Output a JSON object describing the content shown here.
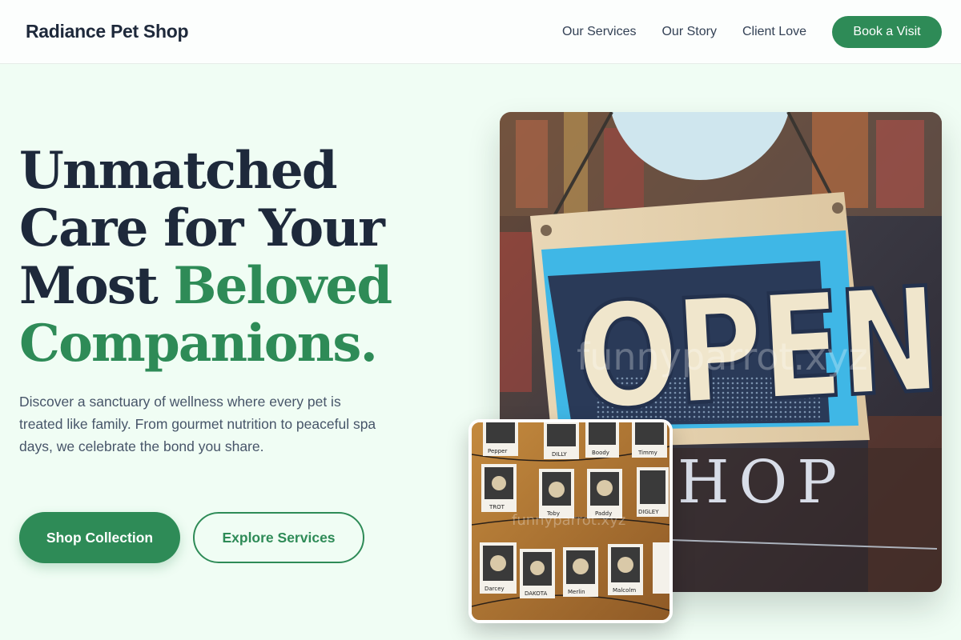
{
  "header": {
    "brand": "Radiance Pet Shop",
    "nav": [
      {
        "label": "Our Services"
      },
      {
        "label": "Our Story"
      },
      {
        "label": "Client Love"
      }
    ],
    "cta_label": "Book a Visit"
  },
  "hero": {
    "title_line1": "Unmatched",
    "title_line2": "Care for Your",
    "title_line3_plain": "Most ",
    "title_line3_accent": "Beloved",
    "title_line4_accent": "Companions.",
    "description": "Discover a sanctuary of wellness where every pet is treated like family. From gourmet nutrition to peaceful spa days, we celebrate the bond you share.",
    "primary_button": "Shop Collection",
    "secondary_button": "Explore Services"
  },
  "images": {
    "main_sign_text": "OPEN",
    "main_window_text": "HOP",
    "watermark": "funnyparrot.xyz",
    "inset_watermark": "funnyparrot.xyz",
    "inset_polaroid_labels": [
      "Pepper",
      "DILLY",
      "Boody",
      "Timmy",
      "TROT",
      "Toby",
      "Paddy",
      "DIGLEY",
      "Darcey",
      "DAKOTA",
      "Merlin",
      "Malcolm"
    ]
  },
  "colors": {
    "accent": "#2e8b57",
    "heading": "#1e293b",
    "background": "#f0fdf4"
  }
}
